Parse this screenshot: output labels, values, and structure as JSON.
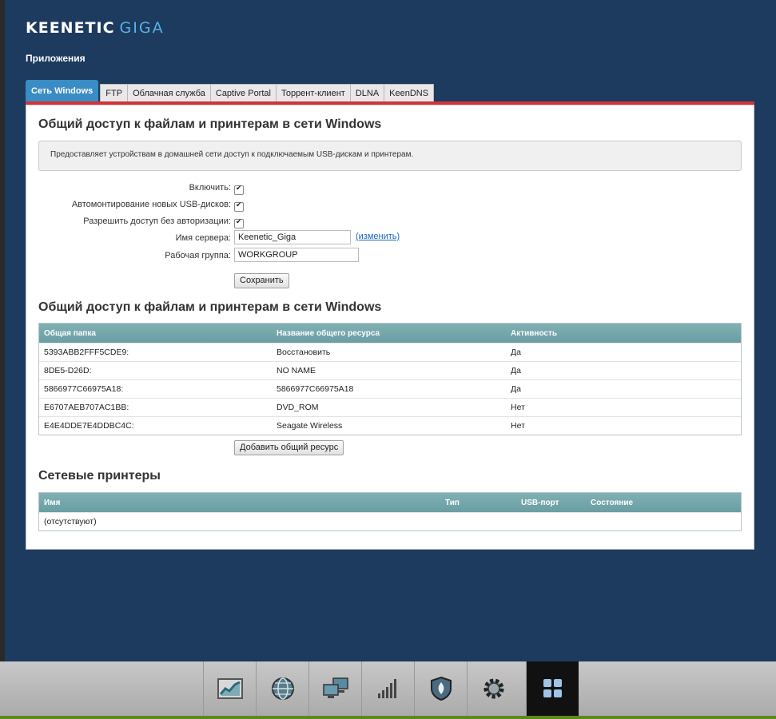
{
  "logo": {
    "brand": "KEENETIC",
    "model": "GIGA"
  },
  "page_title": "Приложения",
  "tabs": [
    {
      "label": "Сеть Windows",
      "active": true
    },
    {
      "label": "FTP"
    },
    {
      "label": "Облачная служба"
    },
    {
      "label": "Captive Portal"
    },
    {
      "label": "Торрент-клиент"
    },
    {
      "label": "DLNA"
    },
    {
      "label": "KeenDNS"
    }
  ],
  "section1": {
    "title": "Общий доступ к файлам и принтерам в сети Windows",
    "info": "Предоставляет устройствам в домашней сети доступ к подключаемым USB-дискам и принтерам.",
    "enable_label": "Включить:",
    "automount_label": "Автомонтирование новых USB-дисков:",
    "noauth_label": "Разрешить доступ без авторизации:",
    "server_name_label": "Имя сервера:",
    "server_name_value": "Keenetic_Giga",
    "change_link": "(изменить)",
    "workgroup_label": "Рабочая группа:",
    "workgroup_value": "WORKGROUP",
    "save_label": "Сохранить"
  },
  "section2": {
    "title": "Общий доступ к файлам и принтерам в сети Windows",
    "columns": [
      "Общая папка",
      "Название общего ресурса",
      "Активность"
    ],
    "rows": [
      [
        "5393ABB2FFF5CDE9:",
        "Восстановить",
        "Да"
      ],
      [
        "8DE5-D26D:",
        "NO NAME",
        "Да"
      ],
      [
        "5866977C66975A18:",
        "5866977C66975A18",
        "Да"
      ],
      [
        "E6707AEB707AC1BB:",
        "DVD_ROM",
        "Нет"
      ],
      [
        "E4E4DDE7E4DDBC4C:",
        "Seagate Wireless",
        "Нет"
      ]
    ],
    "add_label": "Добавить общий ресурс"
  },
  "section3": {
    "title": "Сетевые принтеры",
    "columns": [
      "Имя",
      "Тип",
      "USB-порт",
      "Состояние"
    ],
    "empty": "(отсутствуют)"
  },
  "bottom_nav": [
    {
      "icon": "chart-icon"
    },
    {
      "icon": "globe-icon"
    },
    {
      "icon": "network-computers-icon"
    },
    {
      "icon": "signal-bars-icon"
    },
    {
      "icon": "shield-icon"
    },
    {
      "icon": "gear-icon"
    },
    {
      "icon": "apps-grid-icon",
      "active": true
    }
  ],
  "colors": {
    "background": "#1d3a5f",
    "tab_active": "#3a8cc4",
    "accent_line": "#d0343a",
    "table_header": "#6a9ea3"
  }
}
